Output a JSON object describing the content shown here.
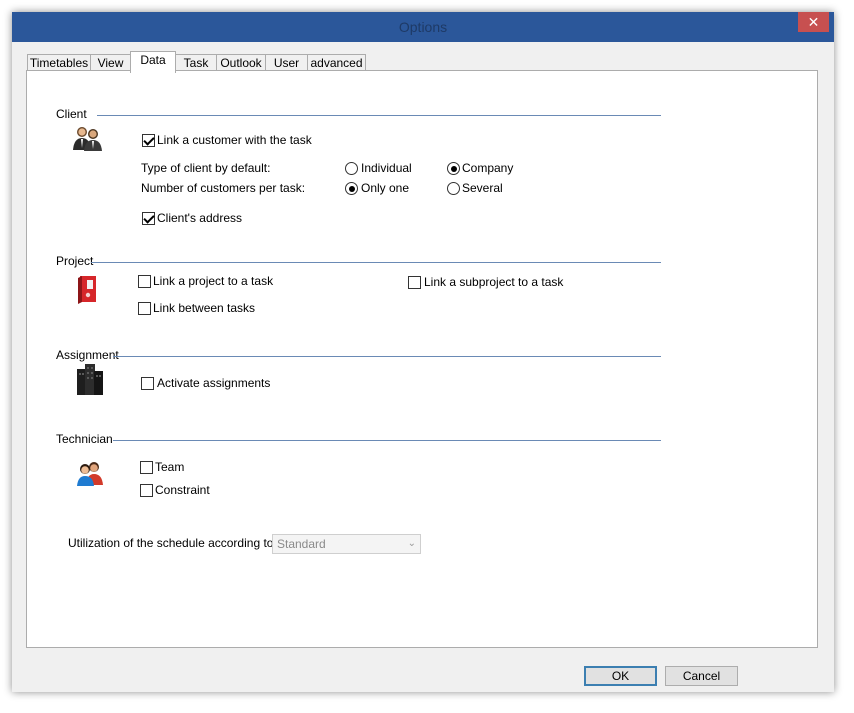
{
  "window": {
    "title": "Options",
    "close_glyph": "✕"
  },
  "tabs": [
    "Timetables",
    "View",
    "Data",
    "Task",
    "Outlook",
    "User",
    "advanced"
  ],
  "active_tab": "Data",
  "client": {
    "label": "Client",
    "icon": "customers-icon",
    "link_customer": {
      "label": "Link a customer with the task",
      "checked": true
    },
    "type_label": "Type of client by default:",
    "type_options": [
      {
        "label": "Individual",
        "selected": false
      },
      {
        "label": "Company",
        "selected": true
      }
    ],
    "count_label": "Number of customers per task:",
    "count_options": [
      {
        "label": "Only one",
        "selected": true
      },
      {
        "label": "Several",
        "selected": false
      }
    ],
    "address": {
      "label": "Client's address",
      "checked": true
    }
  },
  "project": {
    "label": "Project",
    "icon": "project-binder-icon",
    "link_project": {
      "label": "Link a project to a task",
      "checked": false
    },
    "link_subproject": {
      "label": "Link a subproject to a task",
      "checked": false
    },
    "link_between": {
      "label": "Link between tasks",
      "checked": false
    }
  },
  "assignment": {
    "label": "Assignment",
    "icon": "assignment-buildings-icon",
    "activate": {
      "label": "Activate assignments",
      "checked": false
    }
  },
  "technician": {
    "label": "Technician",
    "icon": "technicians-icon",
    "team": {
      "label": "Team",
      "checked": false
    },
    "constraint": {
      "label": "Constraint",
      "checked": false
    }
  },
  "schedule": {
    "label": "Utilization of the schedule according to",
    "value": "Standard"
  },
  "buttons": {
    "ok": "OK",
    "cancel": "Cancel"
  },
  "colors": {
    "frame": "#2b579a",
    "close": "#c75050",
    "group_line": "#6a8ab5"
  }
}
